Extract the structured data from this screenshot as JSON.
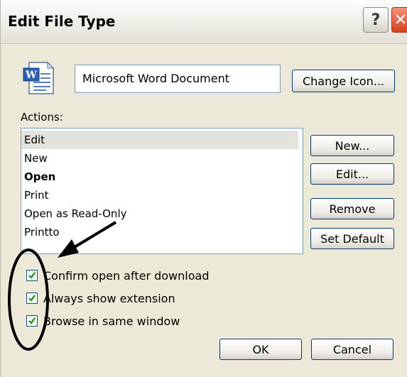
{
  "window": {
    "title": "Edit File Type",
    "help_icon": "question-mark-icon",
    "close_icon": "close-x-icon"
  },
  "file_type": {
    "icon": "word-document-icon",
    "name": "Microsoft Word Document",
    "change_icon_label": "Change Icon..."
  },
  "actions": {
    "label": "Actions:",
    "items": [
      {
        "label": "Edit",
        "selected": true,
        "default": false
      },
      {
        "label": "New",
        "selected": false,
        "default": false
      },
      {
        "label": "Open",
        "selected": false,
        "default": true
      },
      {
        "label": "Print",
        "selected": false,
        "default": false
      },
      {
        "label": "Open as Read-Only",
        "selected": false,
        "default": false
      },
      {
        "label": "Printto",
        "selected": false,
        "default": false
      }
    ],
    "new_label": "New...",
    "edit_label": "Edit...",
    "remove_label": "Remove",
    "set_default_label": "Set Default"
  },
  "options": [
    {
      "label": "Confirm open after download",
      "checked": true
    },
    {
      "label": "Always show extension",
      "checked": true
    },
    {
      "label": "Browse in same window",
      "checked": true
    }
  ],
  "footer": {
    "ok_label": "OK",
    "cancel_label": "Cancel"
  },
  "annotation": {
    "arrow": "arrow-annotation-icon",
    "circle": "ellipse-annotation-icon"
  },
  "colors": {
    "dialog_bg": "#ece9d8",
    "button_border": "#003c74",
    "close_button": "#d6401b",
    "checkmark": "#21a121",
    "annotation": "#000000"
  }
}
